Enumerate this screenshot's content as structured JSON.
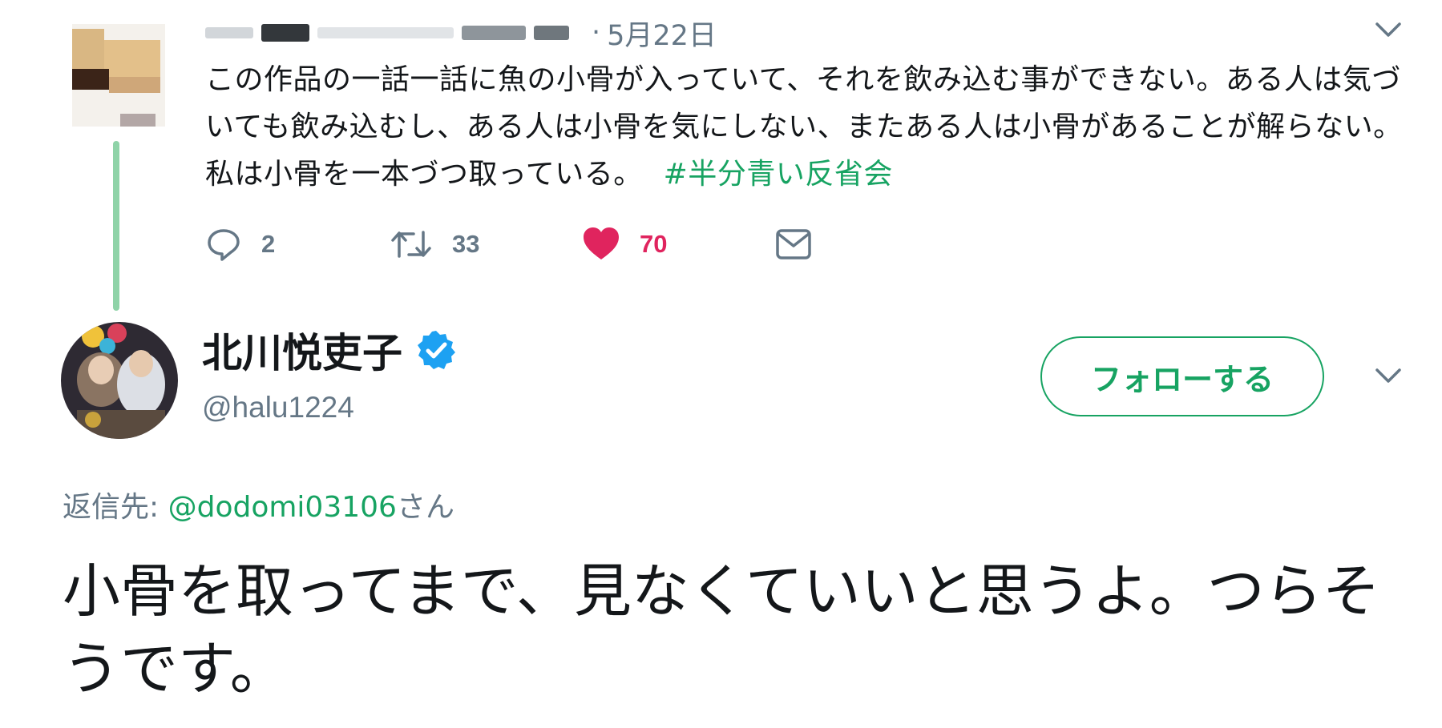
{
  "parent_tweet": {
    "date": "5月22日",
    "text": "この作品の一話一話に魚の小骨が入っていて、それを飲み込む事ができない。ある人は気づいても飲み込むし、ある人は小骨を気にしない、またある人は小骨があることが解らない。私は小骨を一本づつ取っている。",
    "hashtag": "#半分青い反省会",
    "actions": {
      "replies": "2",
      "retweets": "33",
      "likes": "70"
    }
  },
  "main_tweet": {
    "display_name": "北川悦吏子",
    "handle": "@halu1224",
    "follow_label": "フォローする",
    "reply_to_label": "返信先:",
    "reply_to_handle": "@dodomi03106",
    "reply_to_suffix": "さん",
    "text": "小骨を取ってまで、見なくていいと思うよ。つらそうです。"
  },
  "colors": {
    "accent_green": "#17a362",
    "like_red": "#e0245e",
    "verified_blue": "#1da1f2",
    "muted_gray": "#657786",
    "thread_line": "#8fd3a8"
  },
  "icons": [
    "reply-icon",
    "retweet-icon",
    "heart-icon",
    "mail-icon",
    "chevron-down-icon",
    "verified-badge-icon"
  ]
}
